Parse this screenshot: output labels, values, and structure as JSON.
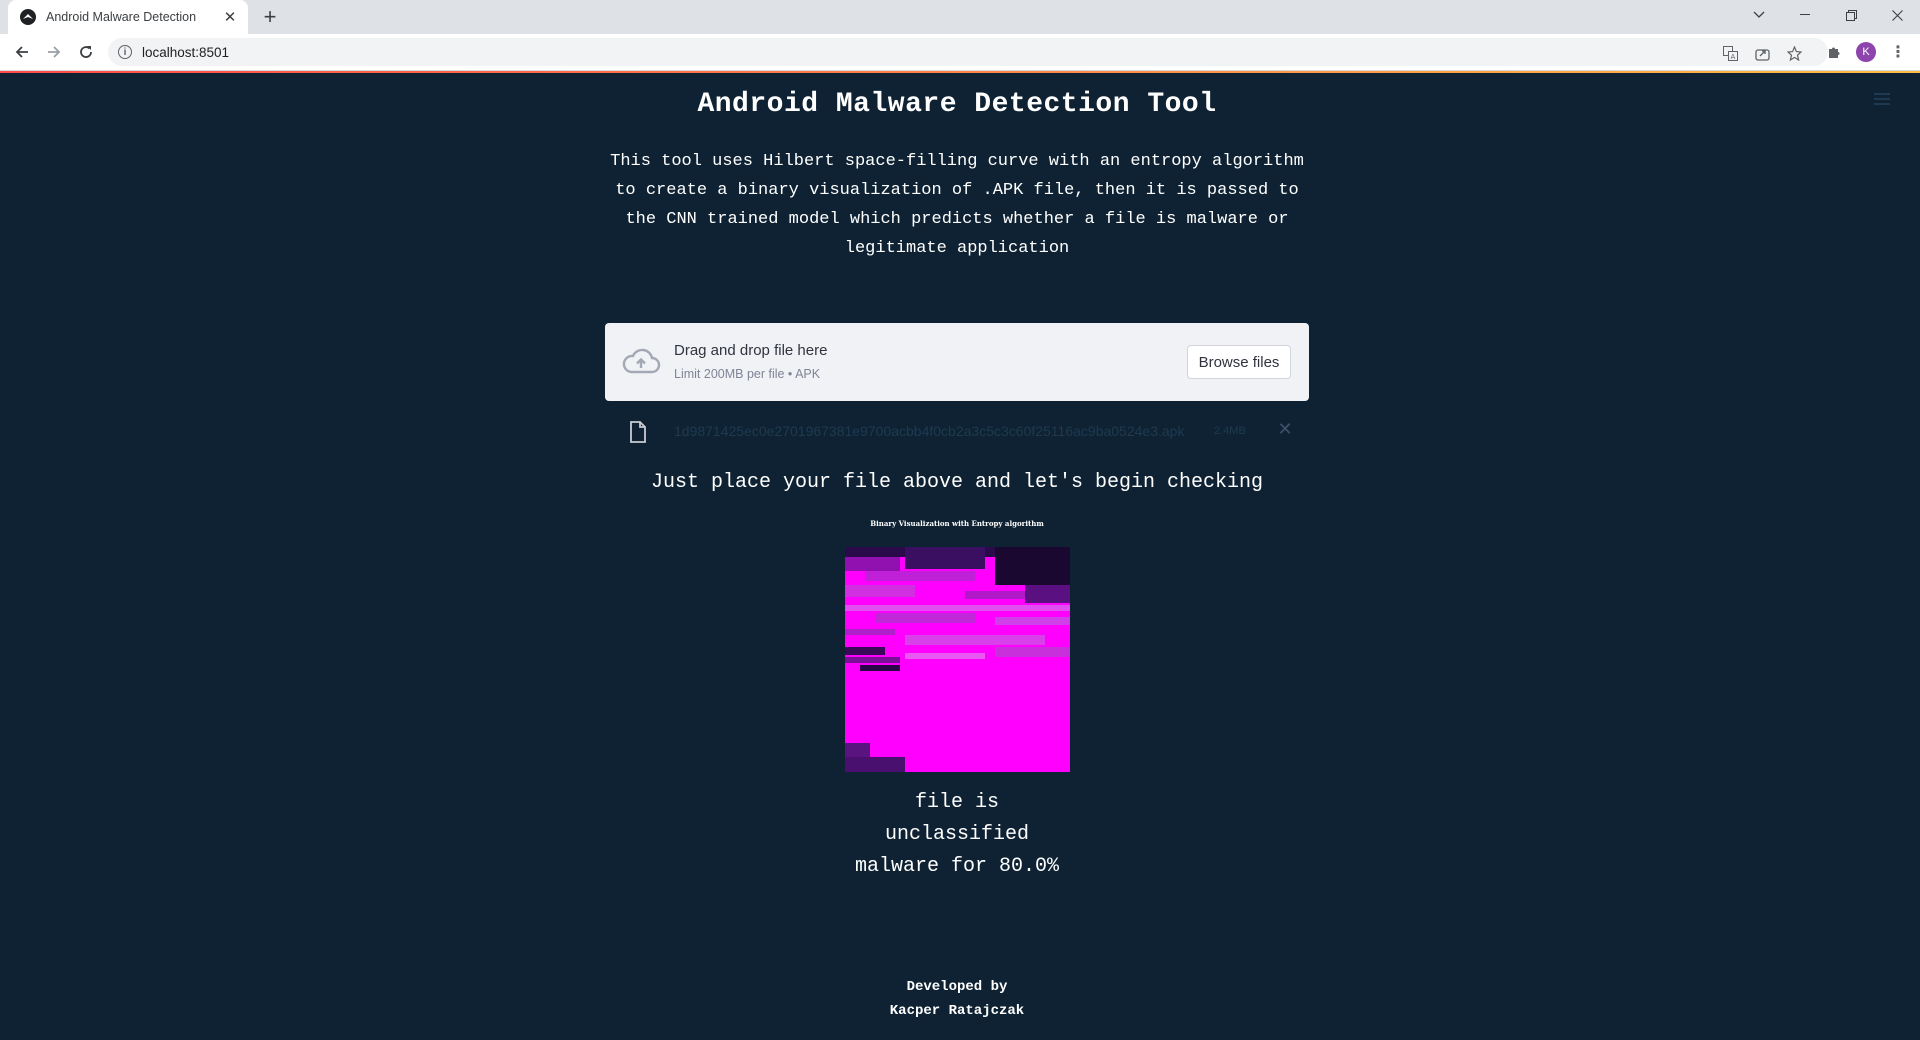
{
  "browser": {
    "tab_title": "Android Malware Detection",
    "url": "localhost:8501",
    "profile_initial": "K"
  },
  "app": {
    "title": "Android Malware Detection Tool",
    "description": "This tool uses Hilbert space-filling curve with an entropy algorithm to create a binary visualization of .APK file, then it is passed to the CNN trained model which predicts whether a file is malware or legitimate application",
    "uploader": {
      "drag_text": "Drag and drop file here",
      "limit_text": "Limit 200MB per file • APK",
      "browse_label": "Browse files"
    },
    "uploaded_file": {
      "name": "1d9871425ec0e2701967381e9700acbb4f0cb2a3c5c3c60f25116ac9ba0524e3.apk",
      "size": "2.4MB"
    },
    "info_text": "Just place your file above and let's begin checking",
    "visualization_caption": "Binary Visualization with Entropy algorithm",
    "result": {
      "line1": "file is",
      "line2": "unclassified",
      "line3": "malware for 80.0%"
    },
    "footer": {
      "line1": "Developed by",
      "line2": "Kacper Ratajczak"
    }
  },
  "colors": {
    "background": "#0e2233",
    "uploader_bg": "#f0f2f6",
    "viz_magenta": "#ff00ff",
    "viz_dark": "#1a0a3a"
  },
  "icons": [
    "streamlit-favicon-icon",
    "close-icon",
    "plus-icon",
    "back-icon",
    "forward-icon",
    "reload-icon",
    "info-icon",
    "translate-icon",
    "share-icon",
    "star-icon",
    "puzzle-icon",
    "more-icon",
    "hamburger-icon",
    "cloud-upload-icon",
    "file-icon"
  ]
}
